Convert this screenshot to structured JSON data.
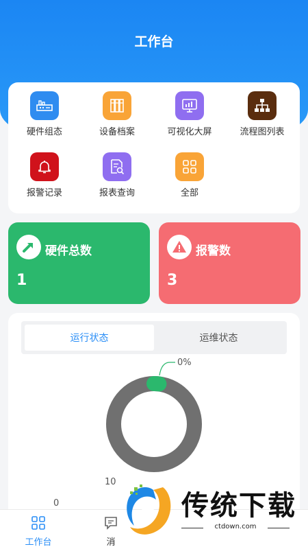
{
  "header": {
    "title": "工作台"
  },
  "menu": {
    "items": [
      {
        "label": "硬件组态",
        "icon": "hardware-config-icon",
        "color": "#2f8cf0"
      },
      {
        "label": "设备档案",
        "icon": "device-archive-icon",
        "color": "#f9a437"
      },
      {
        "label": "可视化大屏",
        "icon": "monitor-screen-icon",
        "color": "#8f6ef0"
      },
      {
        "label": "流程图列表",
        "icon": "flowchart-icon",
        "color": "#5a2d0e"
      },
      {
        "label": "报警记录",
        "icon": "bell-icon",
        "color": "#d0121b"
      },
      {
        "label": "报表查询",
        "icon": "report-search-icon",
        "color": "#8f6ef0"
      },
      {
        "label": "全部",
        "icon": "grid-icon",
        "color": "#f9a437"
      }
    ]
  },
  "stats": {
    "hardware": {
      "title": "硬件总数",
      "value": "1",
      "color": "#2bb86d"
    },
    "alarm": {
      "title": "报警数",
      "value": "3",
      "color": "#f56c72"
    }
  },
  "tabs": [
    {
      "label": "运行状态",
      "active": true
    },
    {
      "label": "运维状态",
      "active": false
    }
  ],
  "donut": {
    "percent_label": "0%",
    "green_fraction": 0.02,
    "gray_color": "#707070",
    "green_color": "#2bb86d",
    "axis_label_10": "10",
    "axis_label_0": "0"
  },
  "bottom_nav": {
    "items": [
      {
        "label": "工作台",
        "active": true
      },
      {
        "label": "消",
        "active": false
      }
    ]
  },
  "watermark": {
    "title": "传统下载",
    "url": "ctdown.com"
  }
}
